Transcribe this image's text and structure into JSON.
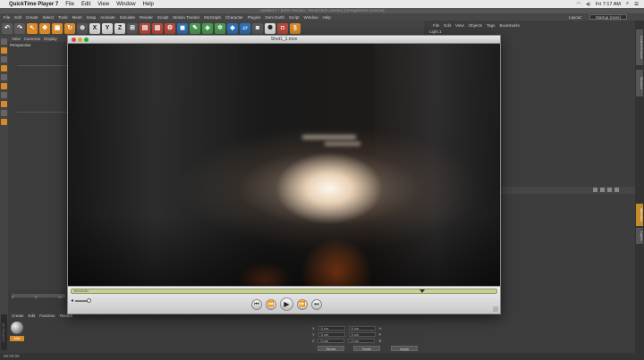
{
  "menubar": {
    "app_name": "QuickTime Player 7",
    "items": [
      "File",
      "Edit",
      "View",
      "Window",
      "Help"
    ],
    "clock": "Fri 7:17 AM"
  },
  "c4d": {
    "title": "Untitled 2 * (NFR Version - Restricted License) [Unregistered License]",
    "menu": [
      "File",
      "Edit",
      "Create",
      "Select",
      "Tools",
      "Mesh",
      "Snap",
      "Animate",
      "Simulate",
      "Render",
      "Sculpt",
      "Motion Tracker",
      "MoGraph",
      "Character",
      "Plugins",
      "Dom Earth",
      "Script",
      "Window",
      "Help"
    ],
    "layout_label": "Layout:",
    "layout_value": "Startup (User)",
    "toolbar_xyz": [
      "X",
      "Y",
      "Z"
    ],
    "viewport_menu": [
      "View",
      "Cameras",
      "Display"
    ],
    "viewport_label": "Perspective",
    "object_menu": [
      "File",
      "Edit",
      "View",
      "Objects",
      "Tags",
      "Bookmarks"
    ],
    "object_item": "Light.1",
    "material_menu": [
      "Create",
      "Edit",
      "Function",
      "Texture"
    ],
    "material_name": "Mat",
    "timeline_ticks": [
      "0",
      "5",
      "10"
    ],
    "coords": {
      "rows": [
        {
          "axis": "X",
          "pos": "0 cm",
          "size": "0 cm",
          "rot": "H"
        },
        {
          "axis": "Y",
          "pos": "0 cm",
          "size": "0 cm",
          "rot": "P"
        },
        {
          "axis": "Z",
          "pos": "0 cm",
          "size": "0 cm",
          "rot": "B"
        }
      ],
      "world": "World",
      "scale": "Scale",
      "apply": "Apply"
    },
    "status": "00:00:00",
    "logo": "CINEMA 4D",
    "right_tabs": [
      "Content Browser",
      "Structure",
      "Attributes",
      "Layers"
    ]
  },
  "quicktime": {
    "title": "Shot1_1.mov",
    "time": "00:00:00",
    "progress": 0.83,
    "buttons": {
      "to_start": "⏮",
      "rewind": "⏪",
      "play": "▶",
      "forward": "⏩",
      "to_end": "⏭"
    },
    "colors": {
      "close": "#e0443e",
      "minimize": "#dea123",
      "zoom": "#1aab29",
      "scrub": "#c6d09a"
    }
  }
}
